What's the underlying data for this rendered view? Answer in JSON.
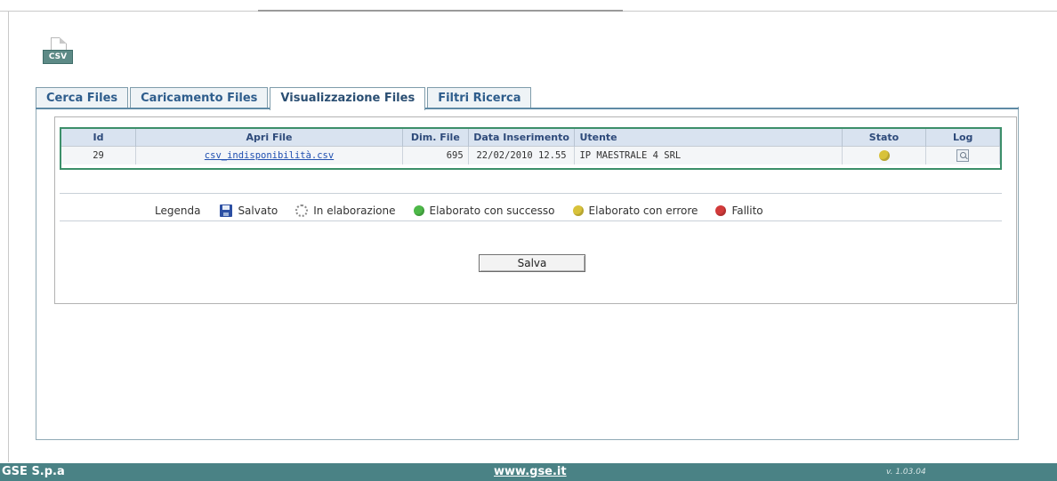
{
  "header": {
    "file_type_badge": "CSV",
    "icon": "csv-file-icon"
  },
  "tabs": [
    {
      "label": "Cerca Files",
      "active": false
    },
    {
      "label": "Caricamento Files",
      "active": false
    },
    {
      "label": "Visualizzazione Files",
      "active": true
    },
    {
      "label": "Filtri Ricerca",
      "active": false
    }
  ],
  "grid": {
    "columns": [
      "Id",
      "Apri File",
      "Dim. File",
      "Data Inserimento",
      "Utente",
      "Stato",
      "Log"
    ],
    "rows": [
      {
        "id": "29",
        "file": "csv_indisponibilità.csv",
        "size": "695",
        "date": "22/02/2010 12.55",
        "user": "IP MAESTRALE 4 SRL",
        "status": "Elaborato con errore",
        "status_color": "#d8c23a",
        "log_icon": "magnifier-icon"
      }
    ]
  },
  "legend": {
    "label": "Legenda",
    "items": [
      {
        "label": "Salvato",
        "icon": "floppy-disk-icon"
      },
      {
        "label": "In elaborazione",
        "icon": "spinner-icon"
      },
      {
        "label": "Elaborato con successo",
        "icon": "green-dot-icon",
        "color": "#4db848"
      },
      {
        "label": "Elaborato con errore",
        "icon": "yellow-dot-icon",
        "color": "#d8c23a"
      },
      {
        "label": "Fallito",
        "icon": "red-dot-icon",
        "color": "#d23a3a"
      }
    ]
  },
  "actions": {
    "save_label": "Salva"
  },
  "footer": {
    "company": "GSE S.p.a",
    "website": "www.gse.it",
    "version": "v. 1.03.04"
  },
  "colors": {
    "footer_bg": "#4a8285",
    "tab_text": "#2e5d8c",
    "grid_border": "#3c8f6a"
  }
}
